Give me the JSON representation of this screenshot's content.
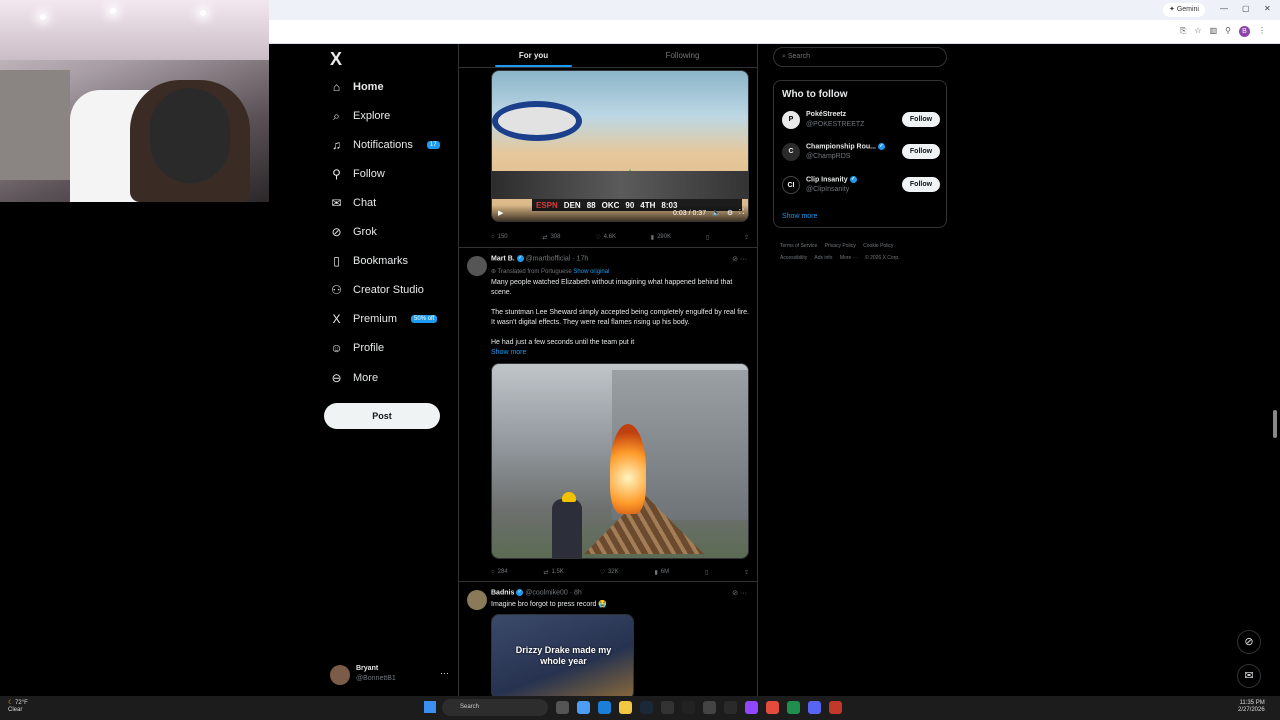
{
  "browser": {
    "gemini_label": "Gemini",
    "profile_initial": "B"
  },
  "nav": {
    "logo": "X",
    "items": [
      {
        "label": "Home",
        "icon": "home-icon",
        "glyph": "⌂"
      },
      {
        "label": "Explore",
        "icon": "search-icon",
        "glyph": "⌕"
      },
      {
        "label": "Notifications",
        "icon": "bell-icon",
        "glyph": "🔔"
      },
      {
        "label": "Follow",
        "icon": "person-add-icon",
        "glyph": "👤"
      },
      {
        "label": "Chat",
        "icon": "chat-icon",
        "glyph": "✉"
      },
      {
        "label": "Grok",
        "icon": "grok-icon",
        "glyph": "⊘"
      },
      {
        "label": "Bookmarks",
        "icon": "bookmark-icon",
        "glyph": "🔖"
      },
      {
        "label": "Creator Studio",
        "icon": "creator-studio-icon",
        "glyph": "⚇"
      },
      {
        "label": "Premium",
        "icon": "x-premium-icon",
        "glyph": "X"
      },
      {
        "label": "Profile",
        "icon": "profile-icon",
        "glyph": "👤"
      },
      {
        "label": "More",
        "icon": "more-circle-icon",
        "glyph": "⋯"
      }
    ],
    "premium_badge": "50% off",
    "notification_count": "17",
    "post_label": "Post",
    "account": {
      "name": "Bryant",
      "handle": "@BonnettB1"
    }
  },
  "feed": {
    "tabs": [
      {
        "label": "For you"
      },
      {
        "label": "Following"
      }
    ],
    "video_tweet": {
      "scoreboard": {
        "team1": "DEN",
        "score1": "88",
        "team2": "OKC",
        "score2": "90",
        "quarter": "4TH",
        "clock": "8:03"
      },
      "time": "0:03 / 0:37",
      "network": "ESPN",
      "sponsor_text": "paycom center",
      "stats": {
        "replies": "150",
        "reposts": "308",
        "likes": "4.6K",
        "views": "290K"
      }
    },
    "tweet1": {
      "name": "Mart B.",
      "handle": "@martbofficial",
      "time": "· 17h",
      "translated": "Translated from Portuguese",
      "show_original": "Show original",
      "p1": "Many people watched Elizabeth without imagining what happened behind that scene.",
      "p2": "The stuntman Lee Sheward simply accepted being completely engulfed by real fire. It wasn't digital effects. They were real flames rising up his body.",
      "p3": "He had just a few seconds until the team put it",
      "show_more": "Show more",
      "stats": {
        "replies": "284",
        "reposts": "1.5K",
        "likes": "32K",
        "views": "6M"
      }
    },
    "tweet2": {
      "name": "Badnis",
      "handle": "@coolmike00",
      "time": "· 8h",
      "text": "Imagine bro forgot to press record 😭",
      "media_caption": "Drizzy Drake made my whole year"
    }
  },
  "sidebar": {
    "search_placeholder": "Search",
    "wtf_title": "Who to follow",
    "accounts": [
      {
        "name": "PokéStreetz",
        "handle": "@POKESTREETZ",
        "avatar": "P"
      },
      {
        "name": "Championship Rou...",
        "handle": "@ChampRDS",
        "avatar": "C"
      },
      {
        "name": "Clip Insanity",
        "handle": "@ClipInsanity",
        "avatar": "CI"
      }
    ],
    "follow_label": "Follow",
    "show_more": "Show more",
    "legal": [
      "Terms of Service",
      "Privacy Policy",
      "Cookie Policy",
      "Accessibility",
      "Ads info",
      "More ···",
      "© 2026 X Corp."
    ]
  },
  "taskbar": {
    "temp": "72°F",
    "weather": "Clear",
    "search": "Search",
    "time": "11:35 PM",
    "date": "2/27/2026"
  }
}
